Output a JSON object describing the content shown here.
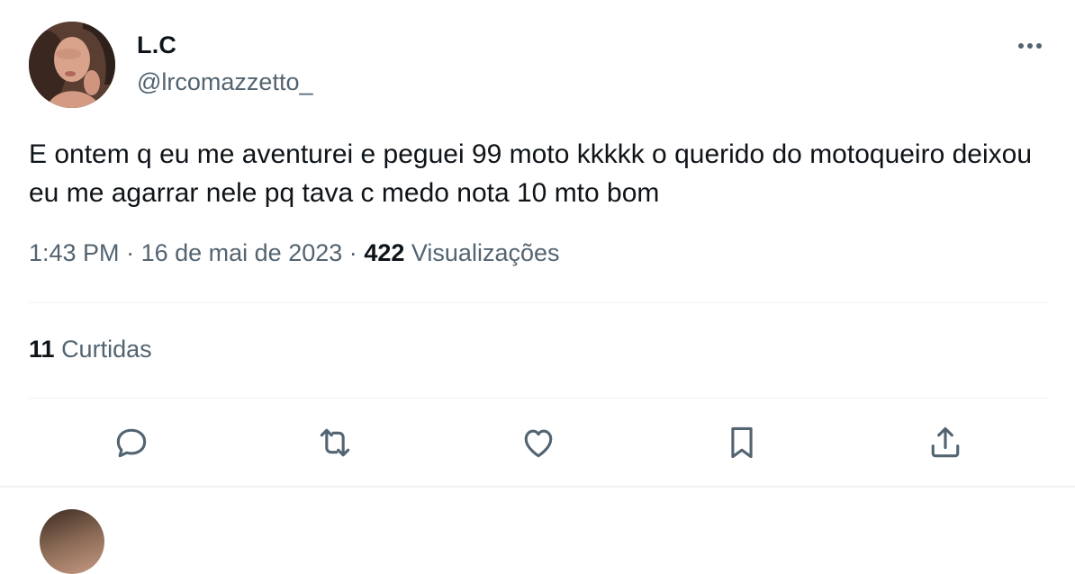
{
  "author": {
    "name": "L.C",
    "handle": "@lrcomazzetto_"
  },
  "tweet": {
    "text": "E ontem q eu me aventurei e peguei 99 moto kkkkk o querido do motoqueiro deixou eu me agarrar nele pq tava c medo nota 10 mto bom",
    "time": "1:43 PM",
    "date": "16 de mai de 2023",
    "separator": "·",
    "views_count": "422",
    "views_label": "Visualizações"
  },
  "engagement": {
    "likes_count": "11",
    "likes_label": "Curtidas"
  },
  "icons": {
    "more": "more-dots-icon",
    "reply": "reply-icon",
    "retweet": "retweet-icon",
    "like": "heart-icon",
    "bookmark": "bookmark-icon",
    "share": "share-icon"
  },
  "colors": {
    "text": "#0f1419",
    "secondary": "#536471",
    "divider": "#eff3f4"
  }
}
